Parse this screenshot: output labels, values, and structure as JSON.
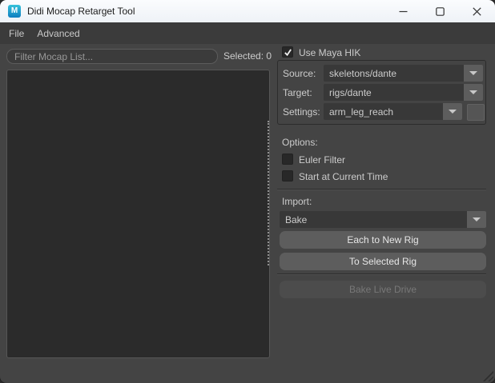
{
  "window": {
    "title": "Didi Mocap Retarget Tool",
    "app_icon_letter": "M"
  },
  "menu": {
    "items": [
      {
        "label": "File"
      },
      {
        "label": "Advanced"
      }
    ]
  },
  "left_panel": {
    "filter_placeholder": "Filter Mocap List...",
    "filter_value": "",
    "selected_label": "Selected: 0",
    "mocap_list_items": []
  },
  "hik": {
    "use_maya_hik_label": "Use Maya HIK",
    "use_maya_hik_checked": true,
    "fields": [
      {
        "label": "Source:",
        "value": "skeletons/dante"
      },
      {
        "label": "Target:",
        "value": "rigs/dante"
      },
      {
        "label": "Settings:",
        "value": "arm_leg_reach"
      }
    ]
  },
  "options": {
    "heading": "Options:",
    "checkboxes": [
      {
        "label": "Euler Filter",
        "checked": false
      },
      {
        "label": "Start at Current Time",
        "checked": false
      }
    ]
  },
  "import_section": {
    "heading": "Import:",
    "mode_value": "Bake",
    "buttons": [
      {
        "label": "Each to New Rig",
        "enabled": true
      },
      {
        "label": "To Selected Rig",
        "enabled": true
      }
    ],
    "live_button": {
      "label": "Bake Live Drive",
      "enabled": false
    }
  },
  "colors": {
    "window_bg": "#444444",
    "menubar_bg": "#3b3b3b",
    "panel_dark": "#2b2b2b",
    "button_bg": "#5d5d5d",
    "titlebar_bg": "#f3f6fa",
    "text": "#cccccc"
  }
}
